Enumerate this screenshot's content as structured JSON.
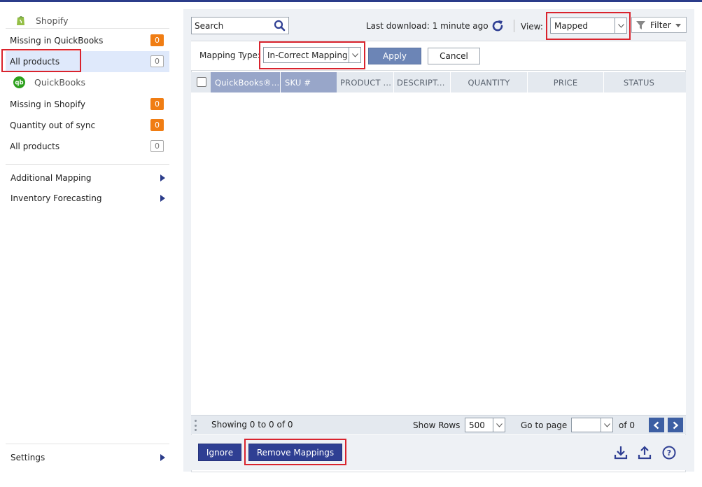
{
  "sidebar": {
    "shopify_header": "Shopify",
    "shopify_items": [
      {
        "label": "Missing in QuickBooks",
        "badge": "0"
      },
      {
        "label": "All products",
        "badge": "0"
      }
    ],
    "quickbooks_header": "QuickBooks",
    "quickbooks_items": [
      {
        "label": "Missing in Shopify",
        "badge": "0"
      },
      {
        "label": "Quantity out of sync",
        "badge": "0"
      },
      {
        "label": "All products",
        "badge": "0"
      }
    ],
    "menu": [
      {
        "label": "Additional Mapping"
      },
      {
        "label": "Inventory Forecasting"
      }
    ],
    "settings": "Settings"
  },
  "toolbar": {
    "search_placeholder": "Search",
    "last_download": "Last download: 1 minute ago",
    "view_label": "View:",
    "view_value": "Mapped",
    "filter_label": "Filter"
  },
  "mapping": {
    "type_label": "Mapping Type:",
    "type_value": "In-Correct Mapping",
    "apply": "Apply",
    "cancel": "Cancel"
  },
  "table": {
    "columns": [
      "QuickBooks®...",
      "SKU #",
      "PRODUCT ...",
      "DESCRIPT...",
      "QUANTITY",
      "PRICE",
      "STATUS"
    ]
  },
  "pager": {
    "showing": "Showing 0 to 0 of 0",
    "show_rows_label": "Show Rows",
    "rows_value": "500",
    "goto_label": "Go to page",
    "page_value": "",
    "of_pages": "of 0"
  },
  "actions": {
    "ignore": "Ignore",
    "remove_mappings": "Remove Mappings"
  },
  "colors": {
    "brand_blue": "#2f3f93",
    "badge_orange": "#f07d13",
    "highlight_red": "#d9232d",
    "active_row": "#dfe9fb"
  }
}
